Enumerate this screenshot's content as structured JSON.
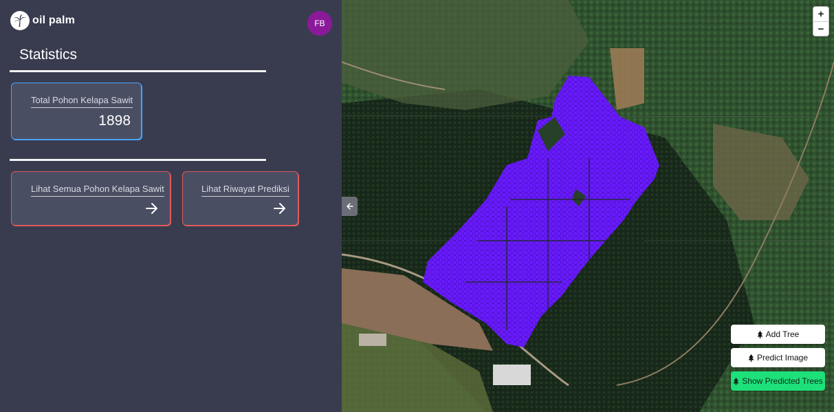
{
  "brand": {
    "name": "oil palm",
    "logo_icon": "palm-tree-icon"
  },
  "user": {
    "initials": "FB",
    "avatar_color": "#8b1a9a"
  },
  "sidebar": {
    "section_title": "Statistics",
    "stat_card": {
      "label": "Total Pohon Kelapa Sawit",
      "value": "1898",
      "accent": "#4aa3ff"
    },
    "link_cards": [
      {
        "label": "Lihat Semua Pohon Kelapa Sawit",
        "icon": "arrow-right-icon",
        "accent": "#e35b5b"
      },
      {
        "label": "Lihat Riwayat Prediksi",
        "icon": "arrow-right-icon",
        "accent": "#e35b5b"
      }
    ]
  },
  "map": {
    "collapse_icon": "arrow-left-icon",
    "zoom_in": "+",
    "zoom_out": "−",
    "prediction_overlay_color": "#6a1bff",
    "actions": [
      {
        "label": "Add Tree",
        "icon": "tree-icon"
      },
      {
        "label": "Predict Image",
        "icon": "tree-icon"
      },
      {
        "label": "Show Predicted Trees",
        "icon": "tree-icon",
        "color": "#1ee07a"
      }
    ]
  }
}
